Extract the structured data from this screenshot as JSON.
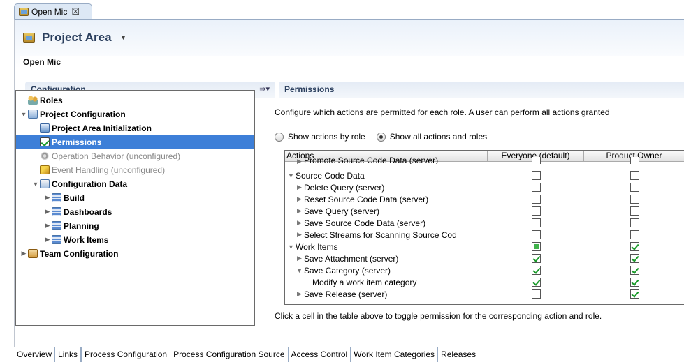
{
  "editor_tab": {
    "label": "Open Mic",
    "close": "☒"
  },
  "header": {
    "title": "Project Area",
    "name_value": "Open Mic"
  },
  "configuration": {
    "title": "Configuration",
    "menu_icon": "⇛▾",
    "tree": [
      {
        "label": "Roles",
        "icon": "roles",
        "indent": 0,
        "bold": true,
        "toggle": "",
        "dim": false,
        "selected": false
      },
      {
        "label": "Project Configuration",
        "icon": "proj",
        "indent": 0,
        "bold": true,
        "toggle": "▼",
        "dim": false,
        "selected": false
      },
      {
        "label": "Project Area Initialization",
        "icon": "init",
        "indent": 1,
        "bold": true,
        "toggle": "",
        "dim": false,
        "selected": false
      },
      {
        "label": "Permissions",
        "icon": "perm",
        "indent": 1,
        "bold": true,
        "toggle": "",
        "dim": false,
        "selected": true
      },
      {
        "label": "Operation Behavior (unconfigured)",
        "icon": "gear",
        "indent": 1,
        "bold": false,
        "toggle": "",
        "dim": true,
        "selected": false
      },
      {
        "label": "Event Handling (unconfigured)",
        "icon": "event",
        "indent": 1,
        "bold": false,
        "toggle": "",
        "dim": true,
        "selected": false
      },
      {
        "label": "Configuration Data",
        "icon": "data",
        "indent": 1,
        "bold": true,
        "toggle": "▼",
        "dim": false,
        "selected": false
      },
      {
        "label": "Build",
        "icon": "build",
        "indent": 2,
        "bold": true,
        "toggle": "▶",
        "dim": false,
        "selected": false
      },
      {
        "label": "Dashboards",
        "icon": "build",
        "indent": 2,
        "bold": true,
        "toggle": "▶",
        "dim": false,
        "selected": false
      },
      {
        "label": "Planning",
        "icon": "build",
        "indent": 2,
        "bold": true,
        "toggle": "▶",
        "dim": false,
        "selected": false
      },
      {
        "label": "Work Items",
        "icon": "build",
        "indent": 2,
        "bold": true,
        "toggle": "▶",
        "dim": false,
        "selected": false
      },
      {
        "label": "Team Configuration",
        "icon": "team",
        "indent": 0,
        "bold": true,
        "toggle": "▶",
        "dim": false,
        "selected": false
      }
    ]
  },
  "permissions": {
    "title": "Permissions",
    "description": "Configure which actions are permitted for each role. A user can perform all actions granted",
    "radio_by_role": "Show actions by role",
    "radio_all": "Show all actions and roles",
    "columns": {
      "actions": "Actions",
      "everyone": "Everyone (default)",
      "owner": "Product Owner"
    },
    "rows": [
      {
        "label": "Promote Source Code Data (server)",
        "indent": 1,
        "toggle": "▶",
        "everyone": "none",
        "owner": "none"
      },
      {
        "label": "Source Code Data",
        "indent": 0,
        "toggle": "▼",
        "everyone": "none",
        "owner": "none"
      },
      {
        "label": "Delete Query (server)",
        "indent": 1,
        "toggle": "▶",
        "everyone": "none",
        "owner": "none"
      },
      {
        "label": "Reset Source Code Data (server)",
        "indent": 1,
        "toggle": "▶",
        "everyone": "none",
        "owner": "none"
      },
      {
        "label": "Save Query (server)",
        "indent": 1,
        "toggle": "▶",
        "everyone": "none",
        "owner": "none"
      },
      {
        "label": "Save Source Code Data (server)",
        "indent": 1,
        "toggle": "▶",
        "everyone": "none",
        "owner": "none"
      },
      {
        "label": "Select Streams for Scanning Source Cod",
        "indent": 1,
        "toggle": "▶",
        "everyone": "none",
        "owner": "none"
      },
      {
        "label": "Work Items",
        "indent": 0,
        "toggle": "▼",
        "everyone": "partial",
        "owner": "checked"
      },
      {
        "label": "Save Attachment (server)",
        "indent": 1,
        "toggle": "▶",
        "everyone": "checked",
        "owner": "checked"
      },
      {
        "label": "Save Category (server)",
        "indent": 1,
        "toggle": "▼",
        "everyone": "checked",
        "owner": "checked"
      },
      {
        "label": "Modify a work item category",
        "indent": 2,
        "toggle": "",
        "everyone": "checked",
        "owner": "checked"
      },
      {
        "label": "Save Release (server)",
        "indent": 1,
        "toggle": "▶",
        "everyone": "none",
        "owner": "checked"
      }
    ],
    "hint": "Click a cell in the table above to toggle permission for the corresponding action and role."
  },
  "bottom_tabs": [
    {
      "label": "Overview",
      "active": false
    },
    {
      "label": "Links",
      "active": false
    },
    {
      "label": "Process Configuration",
      "active": true
    },
    {
      "label": "Process Configuration Source",
      "active": false
    },
    {
      "label": "Access Control",
      "active": false
    },
    {
      "label": "Work Item Categories",
      "active": false
    },
    {
      "label": "Releases",
      "active": false
    }
  ],
  "colors": {
    "selection": "#3d7fd8",
    "section_title": "#2b3f5e",
    "check": "#1a9a2a"
  }
}
